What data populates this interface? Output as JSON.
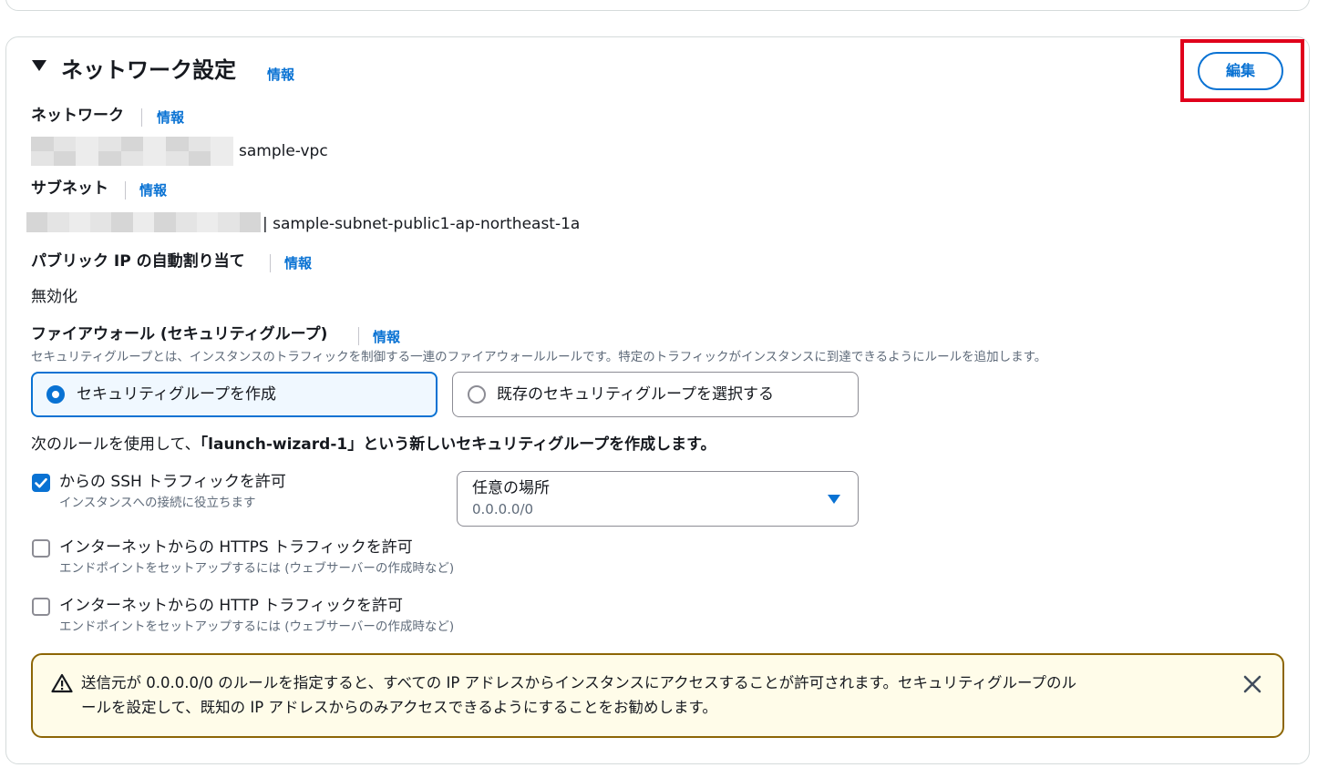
{
  "section": {
    "title": "ネットワーク設定",
    "info": "情報",
    "edit_label": "編集"
  },
  "network": {
    "label": "ネットワーク",
    "info": "情報",
    "value": "sample-vpc"
  },
  "subnet": {
    "label": "サブネット",
    "info": "情報",
    "value": "| sample-subnet-public1-ap-northeast-1a"
  },
  "public_ip": {
    "label": "パブリック IP の自動割り当て",
    "info": "情報",
    "value": "無効化"
  },
  "firewall": {
    "label": "ファイアウォール (セキュリティグループ)",
    "info": "情報",
    "description": "セキュリティグループとは、インスタンスのトラフィックを制御する一連のファイアウォールルールです。特定のトラフィックがインスタンスに到達できるようにルールを追加します。",
    "options": [
      "セキュリティグループを作成",
      "既存のセキュリティグループを選択する"
    ],
    "selected_index": 0
  },
  "rule_intro": {
    "prefix": "次のルールを使用して、",
    "suffix": "「launch-wizard-1」という新しいセキュリティグループを作成します。"
  },
  "rules": [
    {
      "label": "からの SSH トラフィックを許可",
      "description": "インスタンスへの接続に役立ちます",
      "checked": true
    },
    {
      "label": "インターネットからの HTTPS トラフィックを許可",
      "description": "エンドポイントをセットアップするには (ウェブサーバーの作成時など)",
      "checked": false
    },
    {
      "label": "インターネットからの HTTP トラフィックを許可",
      "description": "エンドポイントをセットアップするには (ウェブサーバーの作成時など)",
      "checked": false
    }
  ],
  "source_select": {
    "label": "任意の場所",
    "value": "0.0.0.0/0"
  },
  "warning": {
    "line1": "送信元が 0.0.0.0/0 のルールを指定すると、すべての IP アドレスからインスタンスにアクセスすることが許可されます。セキュリティグループのル",
    "line2": "ールを設定して、既知の IP アドレスからのみアクセスできるようにすることをお勧めします。"
  },
  "colors": {
    "accent": "#0972d3",
    "highlight": "#e0001b",
    "warning_border": "#8d6605",
    "warning_bg": "#fffce9"
  }
}
